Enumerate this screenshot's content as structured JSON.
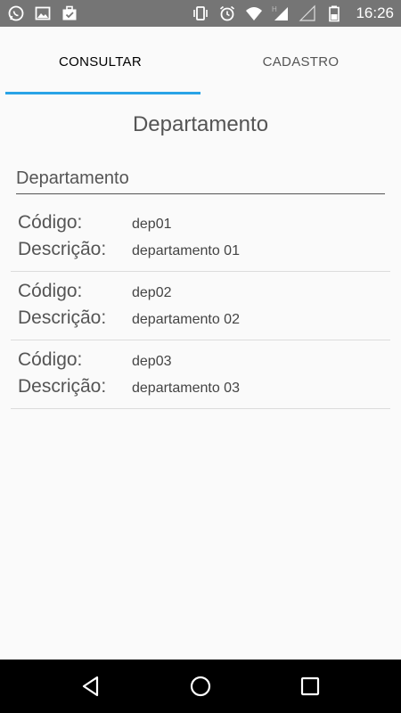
{
  "status_bar": {
    "time": "16:26",
    "left_icons": [
      "whatsapp-icon",
      "image-icon",
      "briefcase-check-icon"
    ],
    "right_icons": [
      "vibrate-icon",
      "alarm-icon",
      "wifi-icon",
      "signal-h-icon",
      "signal-empty-icon",
      "battery-icon"
    ]
  },
  "tabs": [
    {
      "label": "CONSULTAR",
      "active": true
    },
    {
      "label": "CADASTRO",
      "active": false
    }
  ],
  "main": {
    "title": "Departamento",
    "search": {
      "placeholder": "Departamento",
      "value": ""
    },
    "field_labels": {
      "code": "Código:",
      "description": "Descrição:"
    },
    "items": [
      {
        "code": "dep01",
        "description": "departamento 01"
      },
      {
        "code": "dep02",
        "description": "departamento 02"
      },
      {
        "code": "dep03",
        "description": "departamento 03"
      }
    ]
  },
  "nav_bar": {
    "buttons": [
      "back-icon",
      "home-icon",
      "recents-icon"
    ]
  },
  "colors": {
    "accent": "#29a3e6",
    "status_bar": "#757575",
    "background": "#fafafa",
    "nav_bar": "#000000"
  }
}
